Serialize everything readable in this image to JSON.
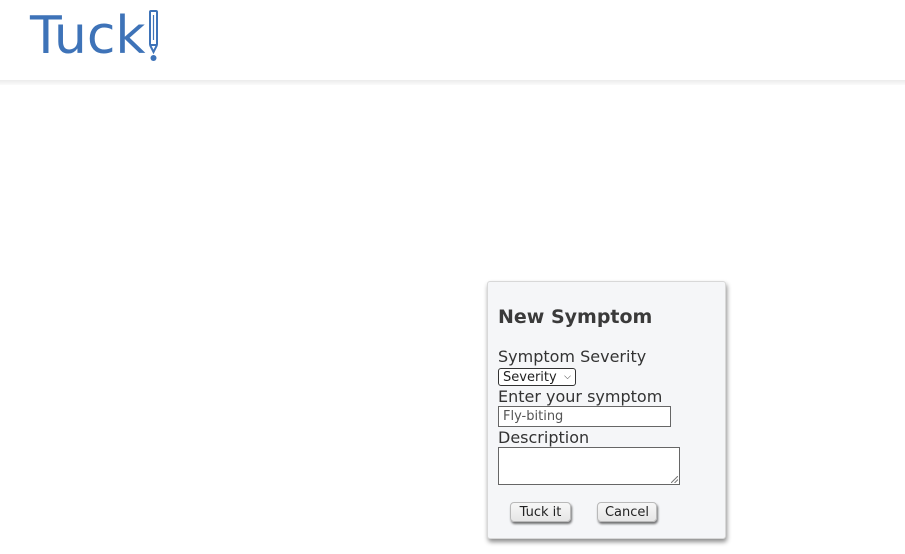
{
  "header": {
    "logo_text": "Tuck",
    "logo_color": "#3e73b8"
  },
  "dialog": {
    "title": "New Symptom",
    "severity_label": "Symptom Severity",
    "severity_selected": "Severity",
    "symptom_label": "Enter your symptom",
    "symptom_value": "Fly-biting",
    "description_label": "Description",
    "description_value": "",
    "submit_label": "Tuck it",
    "cancel_label": "Cancel"
  }
}
